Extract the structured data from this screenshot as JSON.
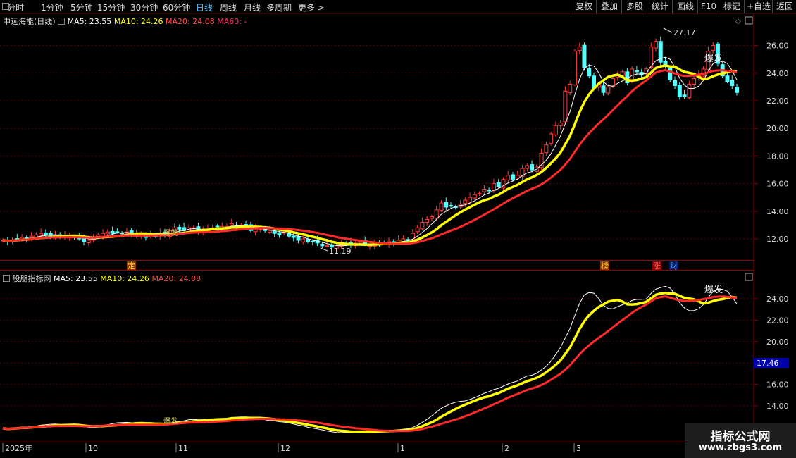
{
  "toolbar": {
    "left": [
      "分时",
      "1分钟",
      "5分钟",
      "15分钟",
      "30分钟",
      "60分钟",
      "日线",
      "周线",
      "月线",
      "多周期",
      "更多 >"
    ],
    "active": "日线",
    "right": [
      "复权",
      "叠加",
      "多股",
      "统计",
      "画线",
      "F10",
      "标记",
      "+自选",
      "返回"
    ]
  },
  "panel1": {
    "title": "中远海能(日线)",
    "ma5": "MA5: 23.55",
    "ma10": "MA10: 24.26",
    "ma20": "MA20: 24.08",
    "ma60": "MA60: -",
    "high_label": "27.17",
    "low_label": "11.19",
    "marker_small": "爆发",
    "marker_top": "爆发",
    "yticks": [
      "26.00",
      "24.00",
      "22.00",
      "20.00",
      "18.00",
      "16.00",
      "14.00",
      "12.00"
    ],
    "events": [
      "定",
      "榜",
      "涨",
      "财"
    ]
  },
  "panel2": {
    "title": "股朋指标网",
    "ma5": "MA5: 23.55",
    "ma10": "MA10: 24.26",
    "ma20": "MA20: 24.08",
    "marker_small": "爆发",
    "marker_top": "爆发",
    "yticks": [
      "24.00",
      "22.00",
      "20.00",
      "18.00",
      "16.00",
      "14.00"
    ],
    "current_value": "17.46"
  },
  "xaxis": [
    "2025年",
    "10",
    "11",
    "12",
    "1",
    "2",
    "3"
  ],
  "watermark": {
    "line1": "指标公式网",
    "line2": "www.zbgs3.com"
  },
  "colors": {
    "up": "#ff3b3b",
    "down": "#54ffff",
    "ma5": "#ffffff",
    "ma10": "#ffff00",
    "ma20": "#ff2a2a",
    "ma60": "#ff3366",
    "grid": "#5a0000"
  },
  "chart_data": [
    {
      "type": "candlestick",
      "title": "中远海能(日线)",
      "y_range": [
        10.5,
        27.8
      ],
      "annotations": [
        {
          "text": "27.17",
          "kind": "high"
        },
        {
          "text": "11.19",
          "kind": "low"
        }
      ],
      "series": [
        {
          "name": "MA5",
          "value": 23.55
        },
        {
          "name": "MA10",
          "value": 24.26
        },
        {
          "name": "MA20",
          "value": 24.08
        },
        {
          "name": "MA60",
          "value": null
        }
      ],
      "close": [
        11.9,
        11.8,
        11.9,
        12.0,
        12.1,
        12.0,
        12.2,
        12.3,
        12.4,
        12.3,
        12.2,
        12.3,
        12.1,
        12.2,
        12.2,
        12.1,
        12.0,
        11.8,
        11.9,
        12.1,
        12.3,
        12.4,
        12.5,
        12.4,
        12.5,
        12.4,
        12.5,
        12.3,
        12.3,
        12.3,
        12.1,
        12.3,
        12.2,
        12.4,
        12.3,
        12.6,
        12.8,
        12.7,
        12.6,
        12.8,
        12.8,
        12.6,
        12.7,
        12.7,
        12.8,
        12.9,
        12.9,
        12.9,
        13.1,
        12.9,
        13.0,
        12.9,
        12.6,
        12.7,
        12.7,
        12.6,
        12.6,
        12.4,
        12.3,
        12.5,
        12.2,
        12.1,
        11.9,
        12.0,
        11.8,
        11.8,
        11.7,
        11.5,
        11.5,
        11.4,
        11.5,
        11.6,
        11.6,
        11.6,
        11.7,
        11.8,
        11.6,
        11.5,
        11.6,
        11.6,
        11.7,
        11.8,
        11.7,
        11.9,
        12.0,
        11.9,
        12.4,
        12.8,
        13.2,
        13.4,
        13.6,
        14.1,
        14.6,
        14.3,
        14.4,
        14.3,
        14.5,
        14.8,
        15.0,
        15.2,
        15.3,
        15.6,
        15.5,
        16.0,
        15.8,
        16.3,
        16.6,
        16.3,
        16.6,
        17.1,
        17.3,
        17.0,
        17.2,
        18.2,
        18.8,
        19.6,
        20.2,
        20.4,
        22.7,
        23.2,
        25.6,
        25.9,
        24.4,
        23.8,
        22.9,
        23.2,
        22.6,
        23.0,
        23.6,
        23.9,
        24.1,
        23.3,
        24.3,
        24.1,
        23.9,
        24.3,
        25.9,
        26.3,
        24.8,
        24.5,
        23.5,
        23.1,
        22.3,
        22.3,
        23.2,
        23.6,
        23.9,
        24.3,
        25.6,
        26.0,
        24.7,
        23.8,
        23.4,
        23.1,
        22.6
      ],
      "events": [
        {
          "text": "定",
          "near": "2025年10月"
        },
        {
          "text": "榜",
          "near": "3月"
        },
        {
          "text": "涨",
          "near": "3月"
        },
        {
          "text": "财",
          "near": "3月"
        }
      ]
    },
    {
      "type": "line",
      "title": "股朋指标网",
      "y_range": [
        12.5,
        26.0
      ],
      "series": [
        {
          "name": "MA5",
          "last": 23.55
        },
        {
          "name": "MA10",
          "last": 24.26
        },
        {
          "name": "MA20",
          "last": 24.08
        }
      ],
      "current_value": 17.46
    }
  ]
}
